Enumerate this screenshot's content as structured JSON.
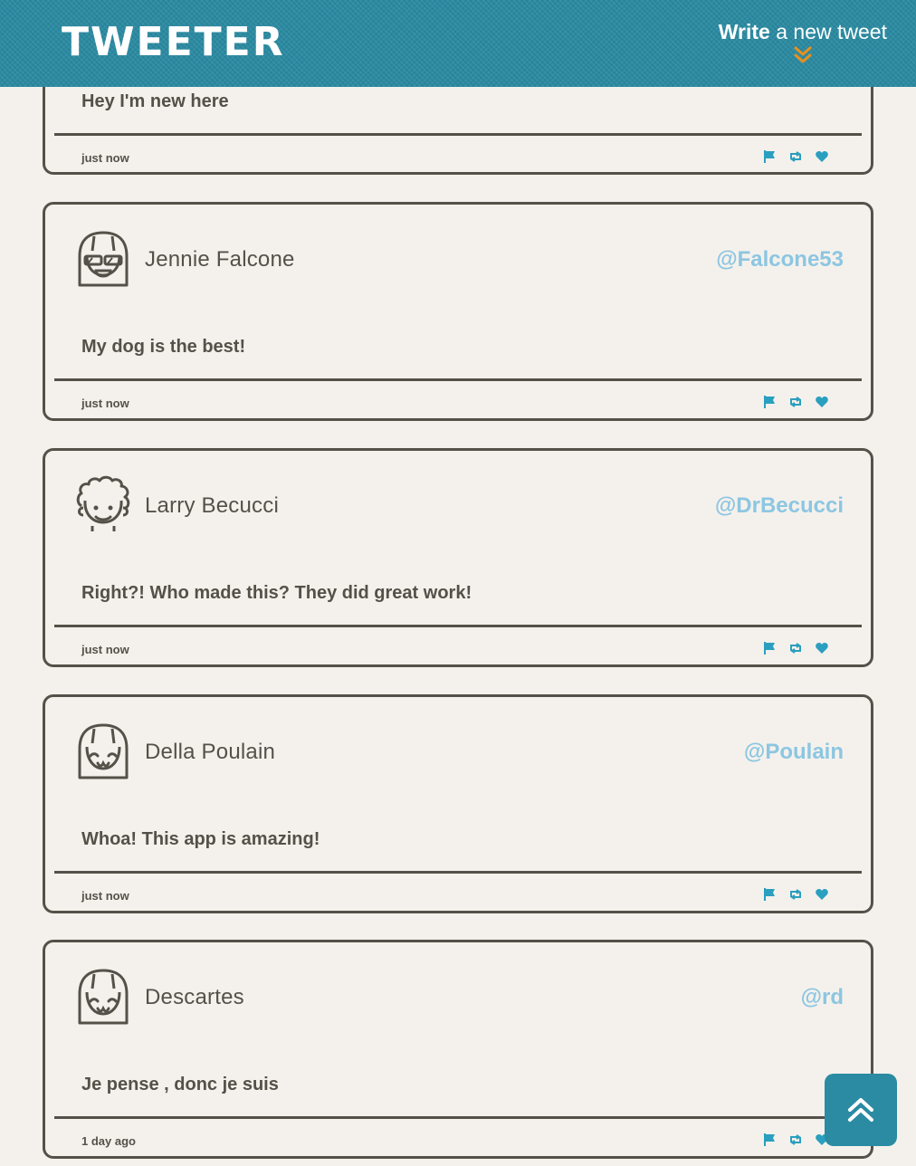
{
  "nav": {
    "logo": "TWEETER",
    "compose_bold": "Write",
    "compose_rest": " a new tweet"
  },
  "colors": {
    "header_bg": "#2a8ba3",
    "page_bg": "#f4f1ec",
    "text": "#545149",
    "handle": "#8cc6e2",
    "icon_accent": "#2a9fbf",
    "chevron": "#e8901e"
  },
  "tweets": [
    {
      "name": "",
      "handle": "",
      "content": "Hey I'm new here",
      "time": "just now"
    },
    {
      "name": "Jennie Falcone",
      "handle": "@Falcone53",
      "content": "My dog is the best!",
      "time": "just now",
      "avatar": "sunglasses-avatar-icon"
    },
    {
      "name": "Larry Becucci",
      "handle": "@DrBecucci",
      "content": "Right?! Who made this? They did great work!",
      "time": "just now",
      "avatar": "curly-hair-avatar-icon"
    },
    {
      "name": "Della Poulain",
      "handle": "@Poulain",
      "content": "Whoa! This app is amazing!",
      "time": "just now",
      "avatar": "bob-hair-avatar-icon"
    },
    {
      "name": "Descartes",
      "handle": "@rd",
      "content": "Je pense , donc je suis",
      "time": "1 day ago",
      "avatar": "bob-hair-avatar-icon"
    }
  ],
  "icons": {
    "flag": "flag-icon",
    "retweet": "retweet-icon",
    "like": "heart-icon",
    "compose_chevron": "double-chevron-down-icon",
    "scroll_top": "double-chevron-up-icon"
  }
}
